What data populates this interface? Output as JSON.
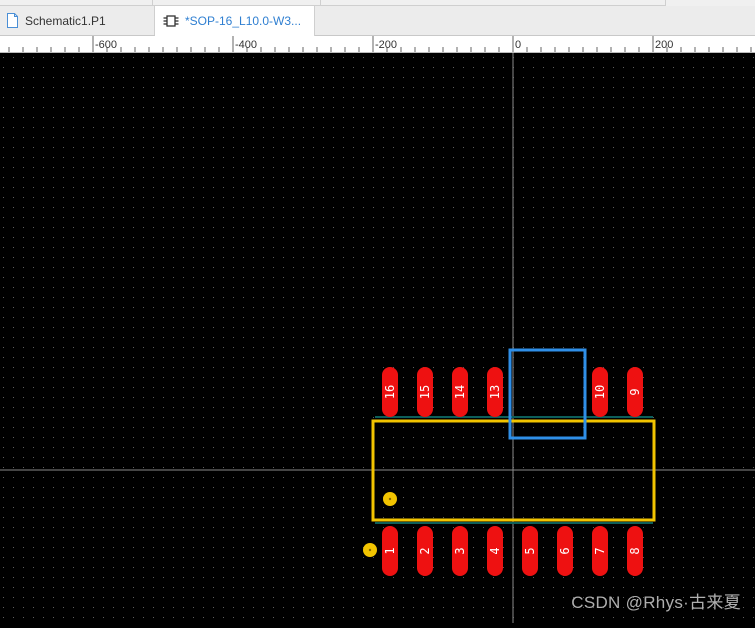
{
  "tabs": [
    {
      "label": "Schematic1.P1",
      "icon": "document-icon",
      "active": false
    },
    {
      "label": "*SOP-16_L10.0-W3...",
      "icon": "footprint-icon",
      "active": true
    }
  ],
  "ruler": {
    "ticks": [
      {
        "value": -600,
        "label": "-600"
      },
      {
        "value": -400,
        "label": "-400"
      },
      {
        "value": -200,
        "label": "-200"
      },
      {
        "value": 0,
        "label": "0"
      },
      {
        "value": 200,
        "label": "200"
      }
    ]
  },
  "footprint": {
    "top_pads": [
      "16",
      "15",
      "14",
      "13",
      "10",
      "9"
    ],
    "bottom_pads": [
      "1",
      "2",
      "3",
      "4",
      "5",
      "6",
      "7",
      "8"
    ]
  },
  "colors": {
    "canvas_bg": "#000000",
    "grid_dot": "#5e5e5e",
    "pad": "#ee1111",
    "pad_text": "#ffffff",
    "silkscreen": "#f2c400",
    "selection_box": "#2f8fe8",
    "crosshair": "#8a8a8a",
    "active_tab_text": "#2f7fd1"
  },
  "watermark": "CSDN @Rhys·古来夏"
}
